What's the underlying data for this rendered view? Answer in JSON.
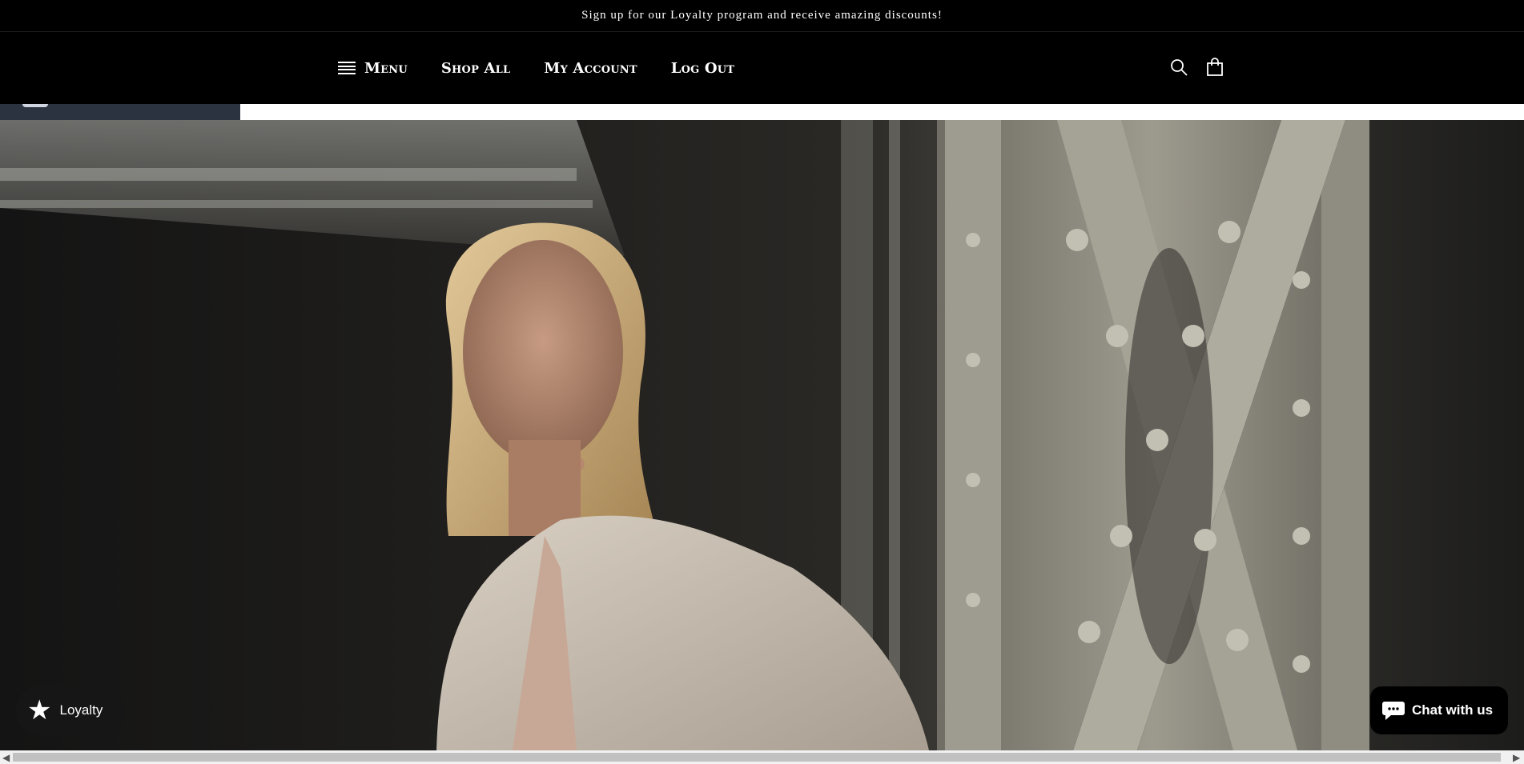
{
  "announcement": {
    "text": "Sign up for our Loyalty program and receive amazing discounts!"
  },
  "nav": {
    "items": [
      {
        "label": "Menu",
        "icon": "hamburger-icon"
      },
      {
        "label": "Shop All"
      },
      {
        "label": "My Account"
      },
      {
        "label": "Log Out"
      }
    ]
  },
  "header_icons": [
    "search-icon",
    "cart-icon"
  ],
  "hero": {
    "description": ""
  },
  "widgets": {
    "loyalty": {
      "label": "Loyalty",
      "icon": "star-icon"
    },
    "chat": {
      "label": "Chat with us",
      "icon": "chat-bubble-icon"
    }
  },
  "colors": {
    "header_bg": "#000000",
    "strip_dark": "#2b3340",
    "chat_bg": "#000000",
    "loyalty_bg": "#161616"
  }
}
